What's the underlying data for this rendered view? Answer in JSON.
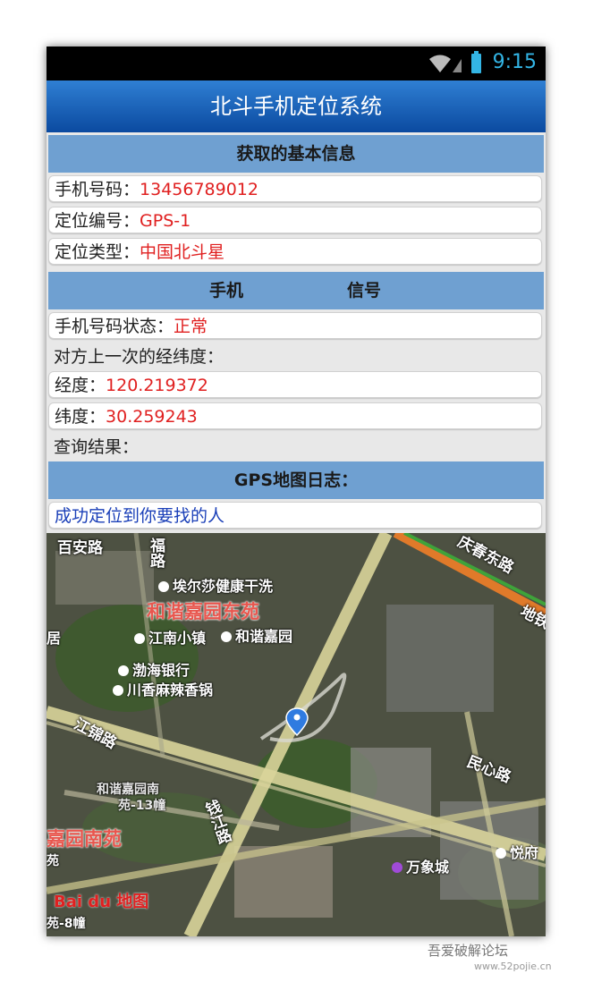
{
  "status_bar": {
    "time": "9:15"
  },
  "app_title": "北斗手机定位系统",
  "basic_info": {
    "header": "获取的基本信息",
    "phone_label": "手机号码：",
    "phone_value": "13456789012",
    "loc_id_label": "定位编号：",
    "loc_id_value": "GPS-1",
    "loc_type_label": "定位类型：",
    "loc_type_value": "中国北斗星"
  },
  "signal_section": {
    "header_left": "手机",
    "header_right": "信号",
    "status_label": "手机号码状态：",
    "status_value": "正常",
    "last_coords_label": "对方上一次的经纬度：",
    "lon_label": "经度：",
    "lon_value": "120.219372",
    "lat_label": "纬度：",
    "lat_value": "30.259243",
    "query_result_label": "查询结果："
  },
  "gps_log": {
    "header": "GPS地图日志：",
    "message": "成功定位到你要找的人"
  },
  "map": {
    "labels": {
      "road_baian": "百安路",
      "road_qingchun_east": "庆春东路",
      "metro": "地铁",
      "road_fu": "福路",
      "poi_laundry": "埃尔莎健康干洗",
      "district_east": "和谐嘉园东苑",
      "poi_jiangnan": "江南小镇",
      "poi_hexie": "和谐嘉园",
      "ju": "居",
      "poi_bohai": "渤海银行",
      "poi_hotpot": "川香麻辣香锅",
      "road_jiangjin": "江锦路",
      "road_minxin": "民心路",
      "district_south_small": "和谐嘉园南",
      "building_13": "苑-13幢",
      "district_south": "嘉园南苑",
      "road_qianjiang": "钱江路",
      "yuan": "苑",
      "poi_wanxiang": "万象城",
      "poi_yuefu": "悦府",
      "building_8": "苑-8幢",
      "baidu_logo": "Bai du 地图"
    }
  },
  "watermark": {
    "line1": "吾爱破解论坛",
    "line2": "www.52pojie.cn"
  }
}
